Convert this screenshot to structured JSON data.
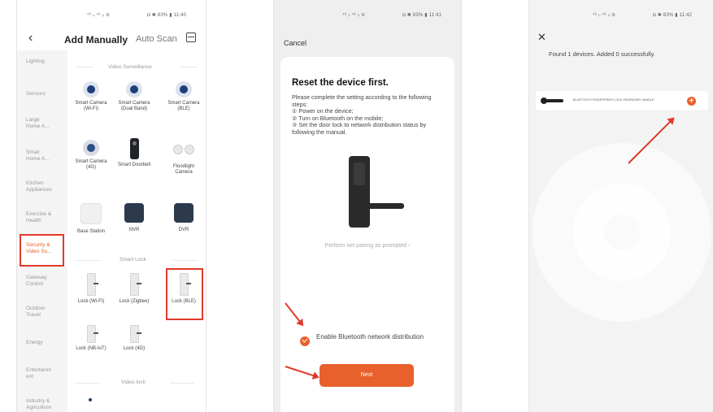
{
  "status_bar": {
    "left": "⁴⁶ ᵢₗ ⁴⁶ ᵢₗ ≋",
    "p1_right": "◘ ✱ 83% ▮ 11:40",
    "p2_right": "◘ ✱ 83% ▮ 11:41",
    "p3_right": "◘ ✱ 83% ▮ 11:42"
  },
  "panel1": {
    "back_icon": "‹",
    "tab_active": "Add Manually",
    "tab_other": "Auto Scan",
    "sidebar": [
      "Lighting",
      "Sensors",
      "Large Home A...",
      "Small Home A...",
      "Kitchen Appliances",
      "Exercise & Health",
      "Security & Video Su...",
      "Gateway Control",
      "Outdoor Travel",
      "Energy",
      "Entertainm ent",
      "Industry & Agriculture"
    ],
    "sections": {
      "video_surveillance": "Video Surveillance",
      "smart_lock": "Smart Lock",
      "video_lock": "Video lock"
    },
    "devices": [
      {
        "label": "Smart Camera (Wi-Fi)",
        "icon": "camera-icon"
      },
      {
        "label": "Smart Camera (Dual Band)",
        "icon": "camera-icon"
      },
      {
        "label": "Smart Camera (BLE)",
        "icon": "camera-icon"
      },
      {
        "label": "Smart Camera (4G)",
        "icon": "camera-icon"
      },
      {
        "label": "Smart Doorbell",
        "icon": "doorbell-icon"
      },
      {
        "label": "Floodlight Camera",
        "icon": "floodlight-icon"
      },
      {
        "label": "Base Station",
        "icon": "base-station-icon"
      },
      {
        "label": "NVR",
        "icon": "nvr-icon"
      },
      {
        "label": "DVR",
        "icon": "dvr-icon"
      },
      {
        "label": "Lock (Wi-Fi)",
        "icon": "lock-icon"
      },
      {
        "label": "Lock (Zigbee)",
        "icon": "lock-icon"
      },
      {
        "label": "Lock (BLE)",
        "icon": "lock-icon"
      },
      {
        "label": "Lock (NB-IoT)",
        "icon": "lock-icon"
      },
      {
        "label": "Lock (4G)",
        "icon": "lock-icon"
      }
    ]
  },
  "panel2": {
    "cancel": "Cancel",
    "title": "Reset the device first.",
    "instructions": [
      "Please complete the setting according to the following steps:",
      "① Power on the device;",
      "② Turn on Bluetooth on the mobile;",
      "③ Set the door lock to network distribution status by following the manual."
    ],
    "prompt_link": "Perform net pairing as prompted  ›",
    "bluetooth_label": "Enable Bluetooth network distribution",
    "next_label": "Next"
  },
  "panel3": {
    "close_icon": "✕",
    "found_text": "Found 1 devices. Added 0 successfully.",
    "device_name": "BLUETOOTH FINGERPRINT LOCK PASSWORD HANDLE",
    "add_icon": "+"
  },
  "colors": {
    "accent": "#e8612c",
    "highlight": "#e03a2a"
  }
}
